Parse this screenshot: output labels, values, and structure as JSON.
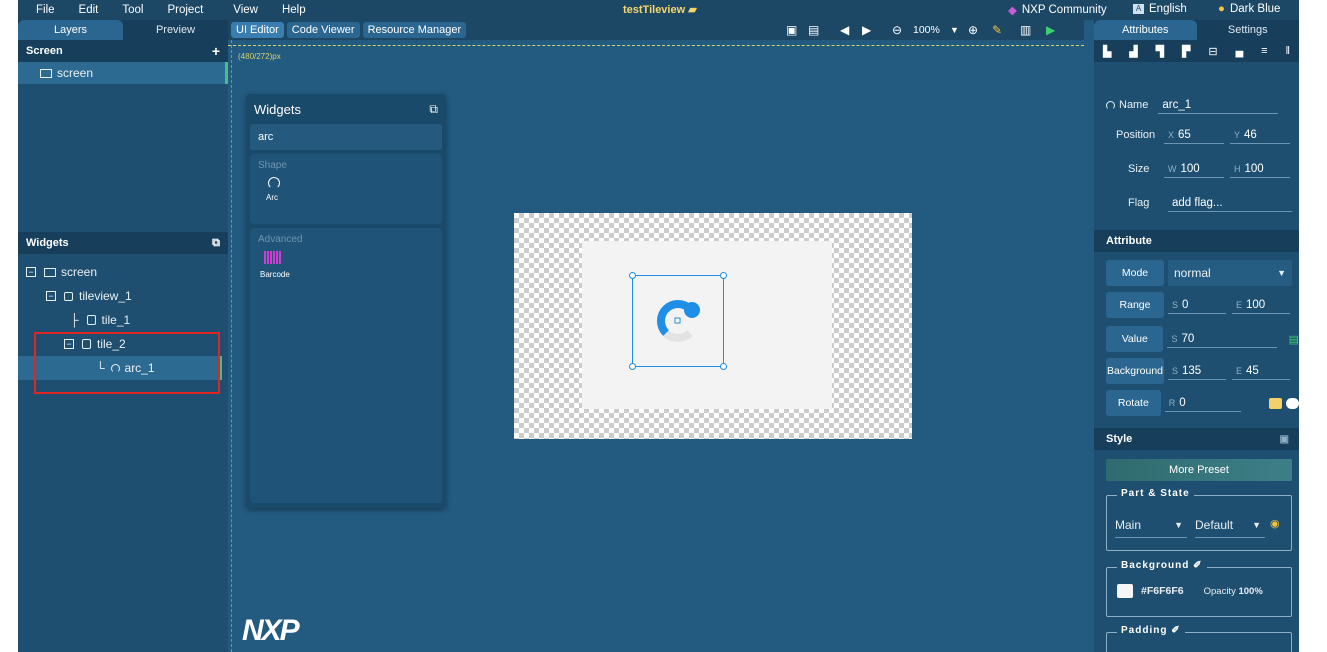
{
  "menu": {
    "items": [
      "File",
      "Edit",
      "Tool",
      "Project",
      "View",
      "Help"
    ],
    "title": "testTileview",
    "community": "NXP Community",
    "language": "English",
    "theme": "Dark Blue"
  },
  "left": {
    "tabs": [
      "Layers",
      "Preview"
    ],
    "screen_header": "Screen",
    "screen_add": "+",
    "screen_item": "screen",
    "widgets_header": "Widgets",
    "tree": [
      "screen",
      "tileview_1",
      "tile_1",
      "tile_2",
      "arc_1"
    ]
  },
  "toolbar": {
    "tabs": [
      "UI Editor",
      "Code Viewer",
      "Resource Manager"
    ],
    "zoom": "100%"
  },
  "canvas": {
    "size_label": "(480/272)px",
    "logo": "NXP"
  },
  "palette": {
    "title": "Widgets",
    "search": "arc",
    "shape_title": "Shape",
    "arc_label": "Arc",
    "advanced_title": "Advanced",
    "barcode_label": "Barcode"
  },
  "right": {
    "tabs": [
      "Attributes",
      "Settings"
    ],
    "name_label": "Name",
    "name_value": "arc_1",
    "position_label": "Position",
    "x_label": "X",
    "x_value": "65",
    "y_label": "Y",
    "y_value": "46",
    "size_label": "Size",
    "w_label": "W",
    "w_value": "100",
    "h_label": "H",
    "h_value": "100",
    "flag_label": "Flag",
    "flag_value": "add flag...",
    "attribute_header": "Attribute",
    "mode_label": "Mode",
    "mode_value": "normal",
    "range_label": "Range",
    "range_s": "0",
    "range_e": "100",
    "value_label": "Value",
    "value_s": "70",
    "bg_label": "Background",
    "bg_s": "135",
    "bg_e": "45",
    "rotate_label": "Rotate",
    "rotate_r": "0",
    "s_label": "S",
    "e_label": "E",
    "r_label": "R",
    "style_header": "Style",
    "more_preset": "More Preset",
    "part_state_title": "Part & State",
    "part_value": "Main",
    "state_value": "Default",
    "background_title": "Background",
    "bg_color": "#F6F6F6",
    "opacity_label": "Opacity",
    "opacity_value": "100%",
    "padding_title": "Padding"
  },
  "colors": {
    "accent": "#1e8ee6",
    "highlight_box": "#e02525",
    "title_yellow": "#f5d66a",
    "panel": "#1e4f70",
    "canvas": "#235a80"
  }
}
